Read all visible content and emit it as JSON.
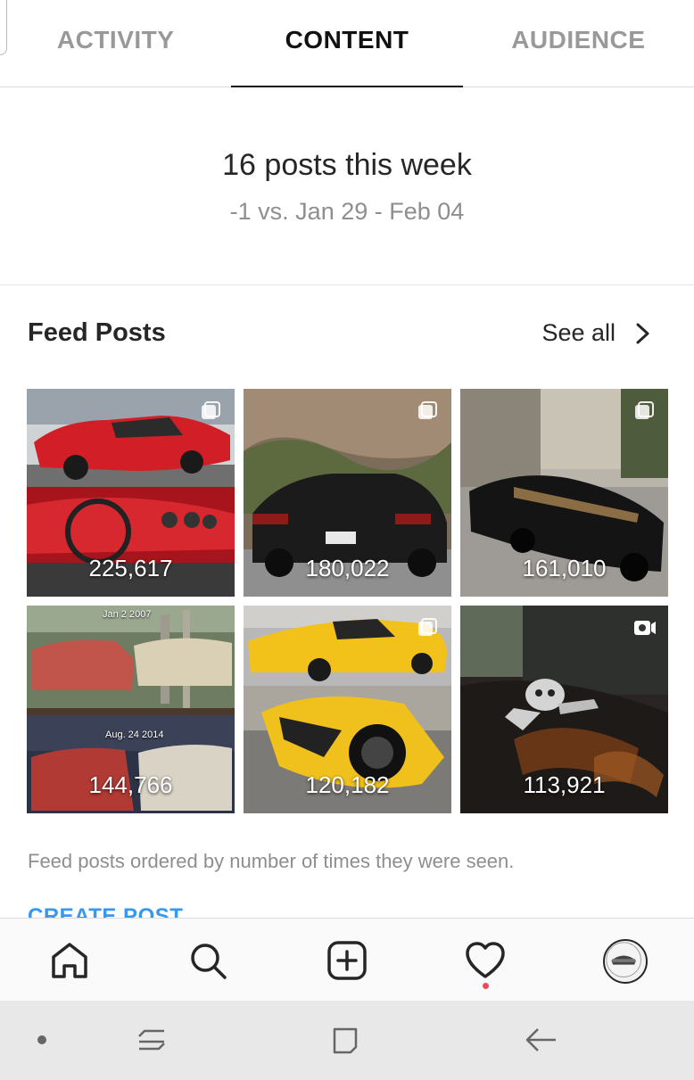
{
  "tabs": [
    {
      "label": "ACTIVITY",
      "active": false
    },
    {
      "label": "CONTENT",
      "active": true
    },
    {
      "label": "AUDIENCE",
      "active": false
    }
  ],
  "summary": {
    "headline": "16 posts this week",
    "comparison": "-1 vs. Jan 29 - Feb 04"
  },
  "feed_posts": {
    "title": "Feed Posts",
    "see_all": "See all",
    "posts": [
      {
        "count": "225,617",
        "type": "carousel"
      },
      {
        "count": "180,022",
        "type": "carousel"
      },
      {
        "count": "161,010",
        "type": "carousel"
      },
      {
        "count": "144,766",
        "type": "image",
        "overlay_top": "Jan 2 2007",
        "overlay_mid": "Aug. 24 2014"
      },
      {
        "count": "120,182",
        "type": "carousel"
      },
      {
        "count": "113,921",
        "type": "video"
      }
    ],
    "footnote": "Feed posts ordered by number of times they were seen.",
    "create_post": "CREATE POST"
  },
  "bottom_nav": {
    "items": [
      "home-icon",
      "search-icon",
      "new-post-icon",
      "activity-heart-icon",
      "profile-avatar"
    ],
    "notification_dot_color": "#ed4956"
  },
  "system_nav": {
    "items": [
      "dot-icon",
      "recents-icon",
      "home-square-icon",
      "back-icon"
    ]
  },
  "colors": {
    "link_blue": "#3897f0",
    "muted_text": "#8e8e8e",
    "primary_text": "#262626"
  }
}
